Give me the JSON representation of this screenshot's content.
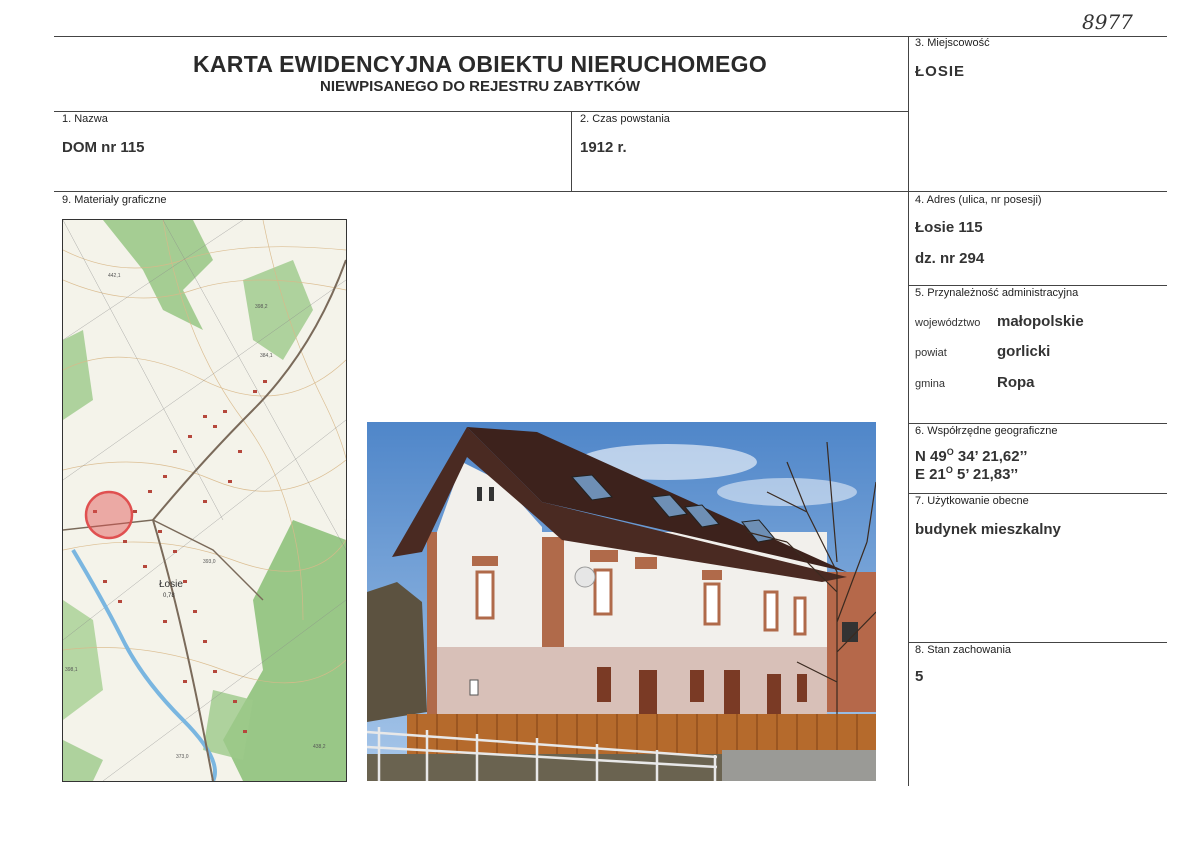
{
  "handwritten_number": "8977",
  "header": {
    "title": "KARTA EWIDENCYJNA OBIEKTU NIERUCHOMEGO",
    "subtitle": "NIEWPISANEGO DO REJESTRU ZABYTKÓW"
  },
  "fields": {
    "miejscowosc": {
      "label": "3. Miejscowość",
      "value": "ŁOSIE"
    },
    "nazwa": {
      "label": "1. Nazwa",
      "value": "DOM nr 115"
    },
    "czas": {
      "label": "2. Czas powstania",
      "value": "1912 r."
    },
    "materialy": {
      "label": "9. Materiały graficzne"
    },
    "adres": {
      "label": "4. Adres (ulica, nr posesji)",
      "value1": "Łosie 115",
      "value2": "dz. nr 294"
    },
    "przynaleznosc": {
      "label": "5. Przynależność administracyjna",
      "wojewodztwo_label": "województwo",
      "wojewodztwo": "małopolskie",
      "powiat_label": "powiat",
      "powiat": "gorlicki",
      "gmina_label": "gmina",
      "gmina": "Ropa"
    },
    "wspolrzedne": {
      "label": "6. Współrzędne geograficzne",
      "n_prefix": "N 49",
      "n_suffix": " 34’ 21,62’’",
      "e_prefix": "E 21",
      "e_suffix": " 5’ 21,83’’",
      "degree": "O"
    },
    "uzytkowanie": {
      "label": "7. Użytkowanie obecne",
      "value": "budynek mieszkalny"
    },
    "stan": {
      "label": "8. Stan zachowania",
      "value": "5"
    }
  },
  "map_labels": {
    "town": "Łosie",
    "town_sub": "0,78",
    "h1": "442,1",
    "h2": "398,2",
    "h3": "384,1",
    "h4": "393,0",
    "h5": "398,1",
    "h6": "438,2",
    "h7": "373,0"
  },
  "colors": {
    "map_green": "#9cc98a",
    "map_bg": "#f4f3ea",
    "marker": "#e05050",
    "roof": "#4a2a22",
    "wall": "#f2f0ec",
    "brick": "#b06a4a",
    "sky": "#6e9fd6",
    "fence": "#b56a2c"
  }
}
